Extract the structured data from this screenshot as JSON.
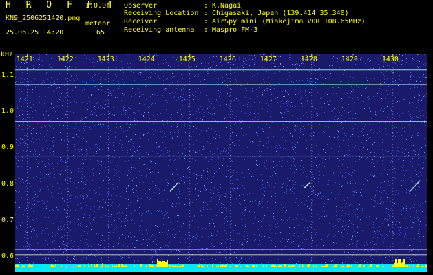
{
  "header": {
    "app_title": "H R O F F T",
    "version": "1.0.0f",
    "filename": "KN9_2506251420.png",
    "datetime": "25.06.25 14:20",
    "meteor_label": "meteor",
    "meteor_count": "65"
  },
  "info": [
    {
      "label": "Observer",
      "value": "K.Nagai"
    },
    {
      "label": "Receiving Location",
      "value": "Chigasaki, Japan (139.414 35.340)"
    },
    {
      "label": "Receiver",
      "value": "AirSpy mini (Miakejima VOR 108.65MHz)"
    },
    {
      "label": "Receiving antenna",
      "value": "Maspro FM-3"
    }
  ],
  "chart_data": {
    "type": "heatmap",
    "ylabel": "kHz",
    "x_ticks": [
      "1421",
      "1422",
      "1423",
      "1424",
      "1425",
      "1426",
      "1427",
      "1428",
      "1429",
      "1430"
    ],
    "y_ticks": [
      "1.1",
      "1.0",
      "0.9",
      "0.8",
      "0.7",
      "0.6"
    ],
    "ylim": [
      0.58,
      1.16
    ],
    "horizontal_lines_khz": [
      1.115,
      1.075,
      0.973,
      0.875,
      0.62,
      0.605
    ],
    "meteor_traces": [
      {
        "x": [
          1424.55,
          1424.75
        ],
        "y": [
          0.78,
          0.805
        ]
      },
      {
        "x": [
          1427.85,
          1428.0
        ],
        "y": [
          0.79,
          0.805
        ]
      },
      {
        "x": [
          1430.45,
          1430.7
        ],
        "y": [
          0.78,
          0.81
        ]
      }
    ],
    "colors": {
      "background": "#1a1a6a",
      "noise": "#3a50d0",
      "line": "#b0f0ff",
      "baseline": "#00e8ff",
      "peaks": "#ffff00"
    }
  }
}
